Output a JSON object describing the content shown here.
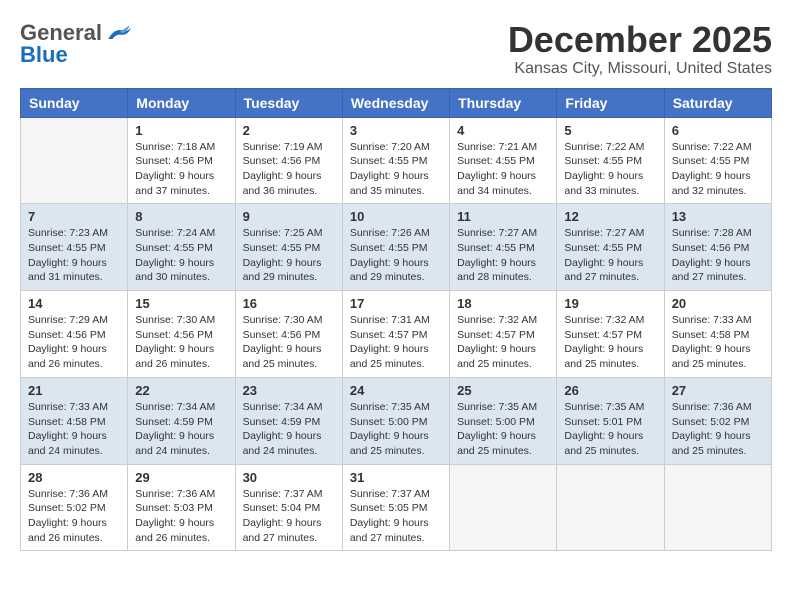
{
  "header": {
    "logo_general": "General",
    "logo_blue": "Blue",
    "month": "December 2025",
    "location": "Kansas City, Missouri, United States"
  },
  "days_of_week": [
    "Sunday",
    "Monday",
    "Tuesday",
    "Wednesday",
    "Thursday",
    "Friday",
    "Saturday"
  ],
  "weeks": [
    [
      {
        "day": "",
        "info": ""
      },
      {
        "day": "1",
        "info": "Sunrise: 7:18 AM\nSunset: 4:56 PM\nDaylight: 9 hours\nand 37 minutes."
      },
      {
        "day": "2",
        "info": "Sunrise: 7:19 AM\nSunset: 4:56 PM\nDaylight: 9 hours\nand 36 minutes."
      },
      {
        "day": "3",
        "info": "Sunrise: 7:20 AM\nSunset: 4:55 PM\nDaylight: 9 hours\nand 35 minutes."
      },
      {
        "day": "4",
        "info": "Sunrise: 7:21 AM\nSunset: 4:55 PM\nDaylight: 9 hours\nand 34 minutes."
      },
      {
        "day": "5",
        "info": "Sunrise: 7:22 AM\nSunset: 4:55 PM\nDaylight: 9 hours\nand 33 minutes."
      },
      {
        "day": "6",
        "info": "Sunrise: 7:22 AM\nSunset: 4:55 PM\nDaylight: 9 hours\nand 32 minutes."
      }
    ],
    [
      {
        "day": "7",
        "info": "Sunrise: 7:23 AM\nSunset: 4:55 PM\nDaylight: 9 hours\nand 31 minutes."
      },
      {
        "day": "8",
        "info": "Sunrise: 7:24 AM\nSunset: 4:55 PM\nDaylight: 9 hours\nand 30 minutes."
      },
      {
        "day": "9",
        "info": "Sunrise: 7:25 AM\nSunset: 4:55 PM\nDaylight: 9 hours\nand 29 minutes."
      },
      {
        "day": "10",
        "info": "Sunrise: 7:26 AM\nSunset: 4:55 PM\nDaylight: 9 hours\nand 29 minutes."
      },
      {
        "day": "11",
        "info": "Sunrise: 7:27 AM\nSunset: 4:55 PM\nDaylight: 9 hours\nand 28 minutes."
      },
      {
        "day": "12",
        "info": "Sunrise: 7:27 AM\nSunset: 4:55 PM\nDaylight: 9 hours\nand 27 minutes."
      },
      {
        "day": "13",
        "info": "Sunrise: 7:28 AM\nSunset: 4:56 PM\nDaylight: 9 hours\nand 27 minutes."
      }
    ],
    [
      {
        "day": "14",
        "info": "Sunrise: 7:29 AM\nSunset: 4:56 PM\nDaylight: 9 hours\nand 26 minutes."
      },
      {
        "day": "15",
        "info": "Sunrise: 7:30 AM\nSunset: 4:56 PM\nDaylight: 9 hours\nand 26 minutes."
      },
      {
        "day": "16",
        "info": "Sunrise: 7:30 AM\nSunset: 4:56 PM\nDaylight: 9 hours\nand 25 minutes."
      },
      {
        "day": "17",
        "info": "Sunrise: 7:31 AM\nSunset: 4:57 PM\nDaylight: 9 hours\nand 25 minutes."
      },
      {
        "day": "18",
        "info": "Sunrise: 7:32 AM\nSunset: 4:57 PM\nDaylight: 9 hours\nand 25 minutes."
      },
      {
        "day": "19",
        "info": "Sunrise: 7:32 AM\nSunset: 4:57 PM\nDaylight: 9 hours\nand 25 minutes."
      },
      {
        "day": "20",
        "info": "Sunrise: 7:33 AM\nSunset: 4:58 PM\nDaylight: 9 hours\nand 25 minutes."
      }
    ],
    [
      {
        "day": "21",
        "info": "Sunrise: 7:33 AM\nSunset: 4:58 PM\nDaylight: 9 hours\nand 24 minutes."
      },
      {
        "day": "22",
        "info": "Sunrise: 7:34 AM\nSunset: 4:59 PM\nDaylight: 9 hours\nand 24 minutes."
      },
      {
        "day": "23",
        "info": "Sunrise: 7:34 AM\nSunset: 4:59 PM\nDaylight: 9 hours\nand 24 minutes."
      },
      {
        "day": "24",
        "info": "Sunrise: 7:35 AM\nSunset: 5:00 PM\nDaylight: 9 hours\nand 25 minutes."
      },
      {
        "day": "25",
        "info": "Sunrise: 7:35 AM\nSunset: 5:00 PM\nDaylight: 9 hours\nand 25 minutes."
      },
      {
        "day": "26",
        "info": "Sunrise: 7:35 AM\nSunset: 5:01 PM\nDaylight: 9 hours\nand 25 minutes."
      },
      {
        "day": "27",
        "info": "Sunrise: 7:36 AM\nSunset: 5:02 PM\nDaylight: 9 hours\nand 25 minutes."
      }
    ],
    [
      {
        "day": "28",
        "info": "Sunrise: 7:36 AM\nSunset: 5:02 PM\nDaylight: 9 hours\nand 26 minutes."
      },
      {
        "day": "29",
        "info": "Sunrise: 7:36 AM\nSunset: 5:03 PM\nDaylight: 9 hours\nand 26 minutes."
      },
      {
        "day": "30",
        "info": "Sunrise: 7:37 AM\nSunset: 5:04 PM\nDaylight: 9 hours\nand 27 minutes."
      },
      {
        "day": "31",
        "info": "Sunrise: 7:37 AM\nSunset: 5:05 PM\nDaylight: 9 hours\nand 27 minutes."
      },
      {
        "day": "",
        "info": ""
      },
      {
        "day": "",
        "info": ""
      },
      {
        "day": "",
        "info": ""
      }
    ]
  ]
}
